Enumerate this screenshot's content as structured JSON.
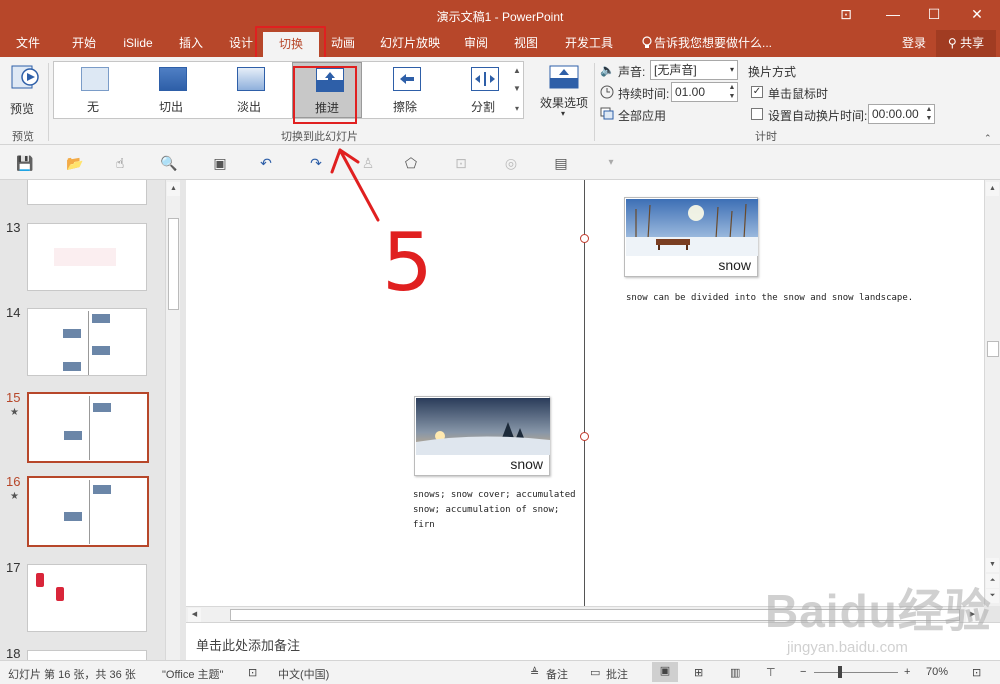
{
  "window": {
    "title": "演示文稿1 - PowerPoint",
    "buttons": [
      "⊡",
      "—",
      "☐",
      "✕"
    ]
  },
  "tabs": {
    "items": [
      "文件",
      "开始",
      "iSlide",
      "插入",
      "设计",
      "切换",
      "动画",
      "幻灯片放映",
      "审阅",
      "视图",
      "开发工具"
    ],
    "active": "切换",
    "tellme": "告诉我您想要做什么...",
    "login": "登录",
    "share": "共享"
  },
  "ribbon": {
    "preview_label": "预览",
    "preview_group": "预览",
    "transitions": [
      "无",
      "切出",
      "淡出",
      "推进",
      "擦除",
      "分割"
    ],
    "selected_transition": "推进",
    "effect_options": "效果选项",
    "group_transition": "切换到此幻灯片",
    "sound_label": "声音:",
    "sound_value": "[无声音]",
    "duration_label": "持续时间:",
    "duration_value": "01.00",
    "apply_all": "全部应用",
    "advance_title": "换片方式",
    "on_click": "单击鼠标时",
    "after_time": "设置自动换片时间:",
    "after_time_value": "00:00.00",
    "group_timing": "计时"
  },
  "slides": [
    {
      "num": "13",
      "star": false,
      "selected": false
    },
    {
      "num": "14",
      "star": false,
      "selected": false
    },
    {
      "num": "15",
      "star": true,
      "selected": true
    },
    {
      "num": "16",
      "star": true,
      "selected": true
    },
    {
      "num": "17",
      "star": false,
      "selected": false
    },
    {
      "num": "18",
      "star": false,
      "selected": false
    }
  ],
  "canvas": {
    "card1_caption": "snow",
    "card1_text": "snow can be divided into the snow and snow landscape.",
    "card2_caption": "snow",
    "card2_text_l1": "snows; snow cover; accumulated",
    "card2_text_l2": "snow; accumulation of snow;",
    "card2_text_l3": "firn"
  },
  "notes_placeholder": "单击此处添加备注",
  "status": {
    "slide_info": "幻灯片 第 16 张，共 36 张",
    "theme": "\"Office 主题\"",
    "language": "中文(中国)",
    "notes": "备注",
    "comments": "批注",
    "zoom": "70%"
  },
  "annotation": {
    "number": "5"
  },
  "watermark": {
    "big": "Baidu经验",
    "small": "jingyan.baidu.com"
  },
  "colors": {
    "accent": "#b7472a",
    "highlight": "#e02020"
  }
}
